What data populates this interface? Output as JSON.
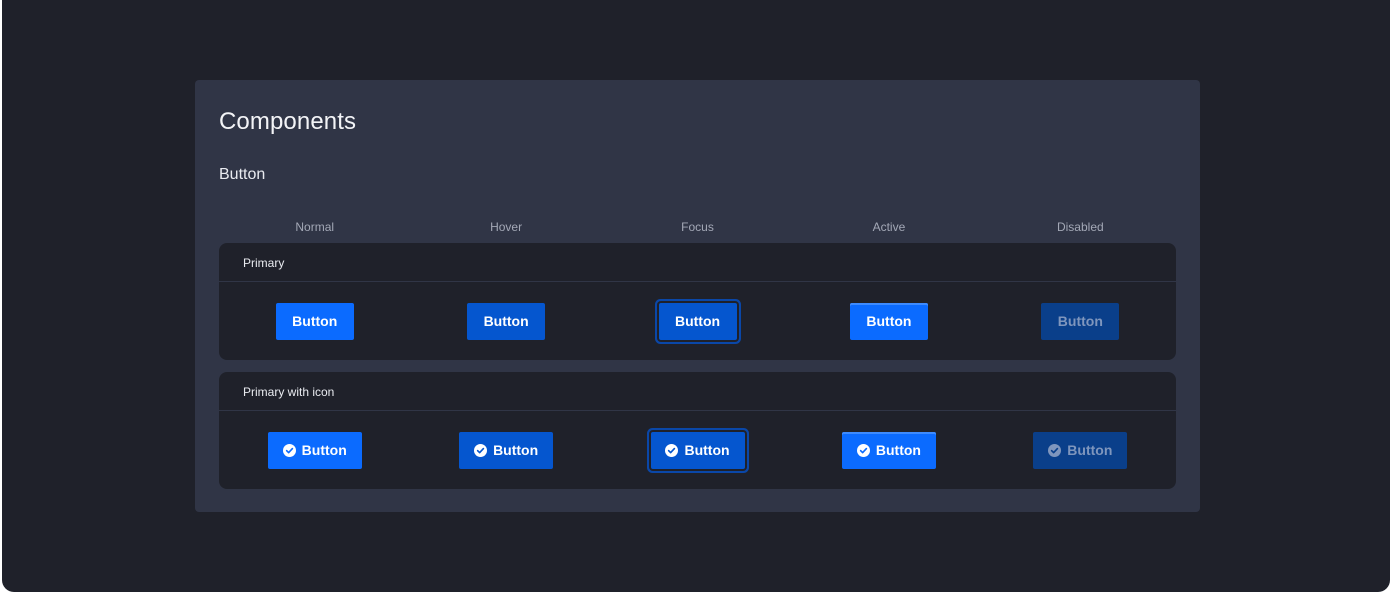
{
  "page": {
    "title": "Components",
    "section": "Button"
  },
  "states": [
    "Normal",
    "Hover",
    "Focus",
    "Active",
    "Disabled"
  ],
  "groups": [
    {
      "label": "Primary",
      "buttons": [
        {
          "state": "normal",
          "label": "Button"
        },
        {
          "state": "hover",
          "label": "Button"
        },
        {
          "state": "focus",
          "label": "Button"
        },
        {
          "state": "active",
          "label": "Button"
        },
        {
          "state": "disabled",
          "label": "Button"
        }
      ]
    },
    {
      "label": "Primary with icon",
      "icon": "check-circle-icon",
      "buttons": [
        {
          "state": "normal",
          "label": "Button"
        },
        {
          "state": "hover",
          "label": "Button"
        },
        {
          "state": "focus",
          "label": "Button"
        },
        {
          "state": "active",
          "label": "Button"
        },
        {
          "state": "disabled",
          "label": "Button"
        }
      ]
    }
  ],
  "colors": {
    "background": "#1f212a",
    "panel": "#303546",
    "primary": "#0b6bff",
    "primary_hover": "#0556cf",
    "primary_disabled": "#0a3f8a",
    "disabled_text": "#7f96bd"
  }
}
